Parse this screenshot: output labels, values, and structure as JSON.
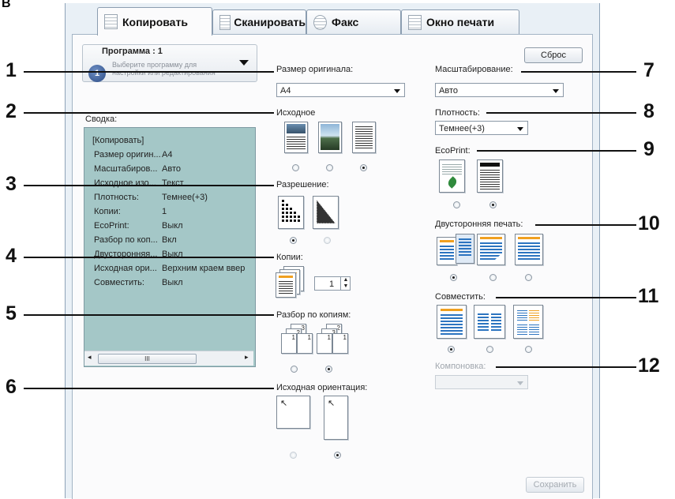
{
  "corner_letter": "B",
  "tabs": [
    {
      "label": "Копировать",
      "active": true
    },
    {
      "label": "Сканировать",
      "active": false
    },
    {
      "label": "Факс",
      "active": false
    },
    {
      "label": "Окно печати",
      "active": false
    }
  ],
  "program": {
    "number_badge": "1",
    "title": "Программа : 1",
    "subtitle": "Выберите программу для настройки или редактирования"
  },
  "reset_button": "Сброс",
  "save_button": "Сохранить",
  "summary": {
    "label": "Сводка:",
    "header": "[Копировать]",
    "rows": [
      {
        "key": "Размер оригин...",
        "value": "A4"
      },
      {
        "key": "Масштабиров...",
        "value": "Авто"
      },
      {
        "key": "Исходное изо...",
        "value": "Текст"
      },
      {
        "key": "Плотность:",
        "value": "Темнее(+3)"
      },
      {
        "key": "Копии:",
        "value": "1"
      },
      {
        "key": "EcoPrint:",
        "value": "Выкл"
      },
      {
        "key": "Разбор по коп...",
        "value": "Вкл"
      },
      {
        "key": "Двусторонняя...",
        "value": "Выкл"
      },
      {
        "key": "Исходная ори...",
        "value": "Верхним краем ввер"
      },
      {
        "key": "Совместить:",
        "value": "Выкл"
      }
    ],
    "scroll_thumb": "III"
  },
  "settings": {
    "original_size": {
      "label": "Размер оригинала:",
      "value": "A4"
    },
    "original_image": {
      "label": "Исходное",
      "selected_index": 2
    },
    "resolution": {
      "label": "Разрешение:",
      "selected_index": 0
    },
    "copies": {
      "label": "Копии:",
      "value": "1"
    },
    "collate": {
      "label": "Разбор по копиям:",
      "selected_index": 1,
      "icon_digits": [
        "3",
        "2",
        "1",
        "1",
        "2",
        "3",
        "1",
        "1",
        "2",
        "3",
        "3",
        "2",
        "1"
      ]
    },
    "orientation": {
      "label": "Исходная ориентация:",
      "selected_index": 1,
      "arrow": "↖"
    },
    "zoom": {
      "label": "Масштабирование:",
      "value": "Авто"
    },
    "density": {
      "label": "Плотность:",
      "value": "Темнее(+3)"
    },
    "ecoprint": {
      "label": "EcoPrint:",
      "selected_index": 1
    },
    "duplex": {
      "label": "Двусторонняя печать:",
      "selected_index": 0
    },
    "combine": {
      "label": "Совместить:",
      "selected_index": 0
    },
    "layout": {
      "label": "Компоновка:",
      "value": ""
    }
  },
  "callouts": [
    "1",
    "2",
    "3",
    "4",
    "5",
    "6",
    "7",
    "8",
    "9",
    "10",
    "11",
    "12"
  ]
}
